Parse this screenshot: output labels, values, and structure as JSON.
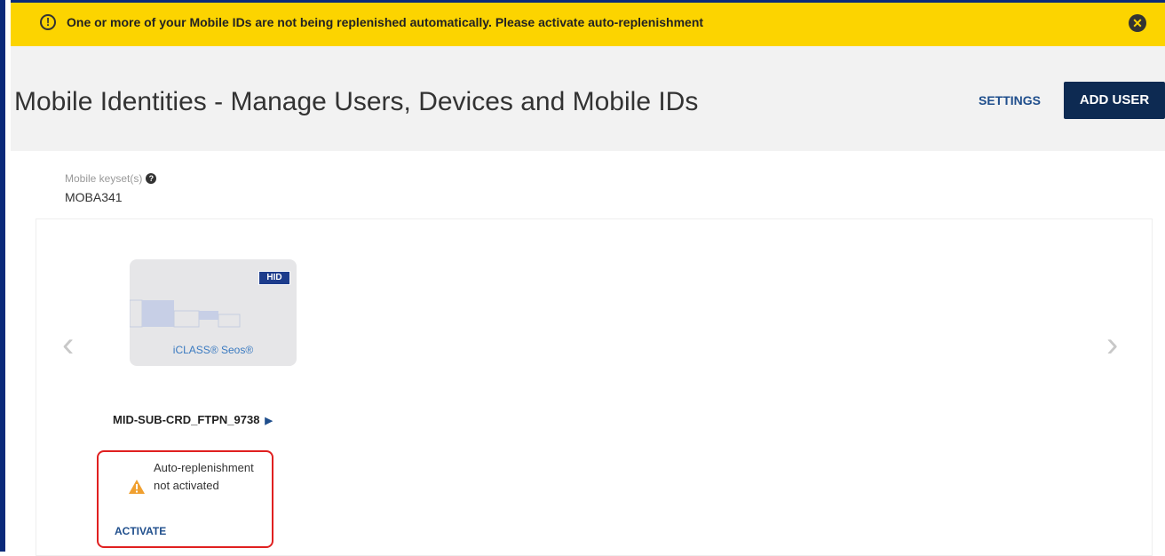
{
  "banner": {
    "message": "One or more of your Mobile IDs are not being replenished automatically. Please activate auto-replenishment",
    "info_icon": "!",
    "close_icon": "✕",
    "color": "#fcd400"
  },
  "header": {
    "title": "Mobile Identities - Manage Users, Devices and Mobile IDs",
    "settings_label": "SETTINGS",
    "add_user_label": "ADD USER"
  },
  "keyset": {
    "label": "Mobile keyset(s)",
    "help_icon": "?",
    "value": "MOBA341"
  },
  "carousel": {
    "prev_icon": "‹",
    "next_icon": "›",
    "card": {
      "logo": "HID",
      "brand": "iCLASS® Seos®",
      "name": "MID-SUB-CRD_FTPN_9738",
      "expand_icon": "▶"
    },
    "alert": {
      "message": "Auto-replenishment not activated",
      "action_label": "ACTIVATE",
      "icon": "warning-icon"
    }
  },
  "colors": {
    "primary": "#0d2a52",
    "link": "#1f4e8c",
    "warning": "#f0a030",
    "alert_border": "#e02020"
  }
}
